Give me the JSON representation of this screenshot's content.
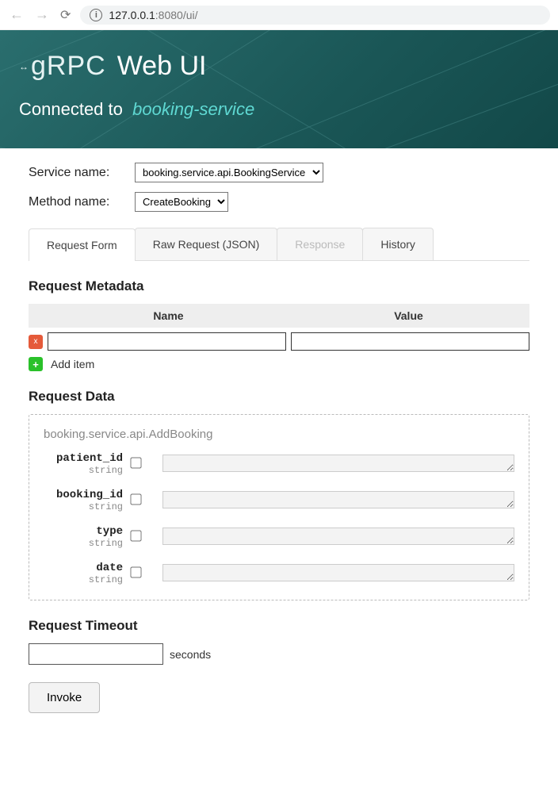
{
  "browser": {
    "back": "←",
    "forward": "→",
    "reload": "⟳",
    "info_glyph": "i",
    "url_host": "127.0.0.1",
    "url_port": ":8080",
    "url_path": "/ui/"
  },
  "banner": {
    "logo_text": "gRPC",
    "title": "Web UI",
    "connected_label": "Connected to",
    "service_name": "booking-service"
  },
  "selectors": {
    "service_label": "Service name:",
    "service_value": "booking.service.api.BookingService",
    "method_label": "Method name:",
    "method_value": "CreateBooking"
  },
  "tabs": [
    {
      "label": "Request Form",
      "state": "active"
    },
    {
      "label": "Raw Request (JSON)",
      "state": "normal"
    },
    {
      "label": "Response",
      "state": "disabled"
    },
    {
      "label": "History",
      "state": "normal"
    }
  ],
  "metadata": {
    "heading": "Request Metadata",
    "col_name": "Name",
    "col_value": "Value",
    "delete_glyph": "x",
    "add_glyph": "+",
    "add_label": "Add item"
  },
  "request_data": {
    "heading": "Request Data",
    "schema": "booking.service.api.AddBooking",
    "fields": [
      {
        "name": "patient_id",
        "type": "string"
      },
      {
        "name": "booking_id",
        "type": "string"
      },
      {
        "name": "type",
        "type": "string"
      },
      {
        "name": "date",
        "type": "string"
      }
    ]
  },
  "timeout": {
    "heading": "Request Timeout",
    "units": "seconds",
    "value": ""
  },
  "invoke_label": "Invoke"
}
